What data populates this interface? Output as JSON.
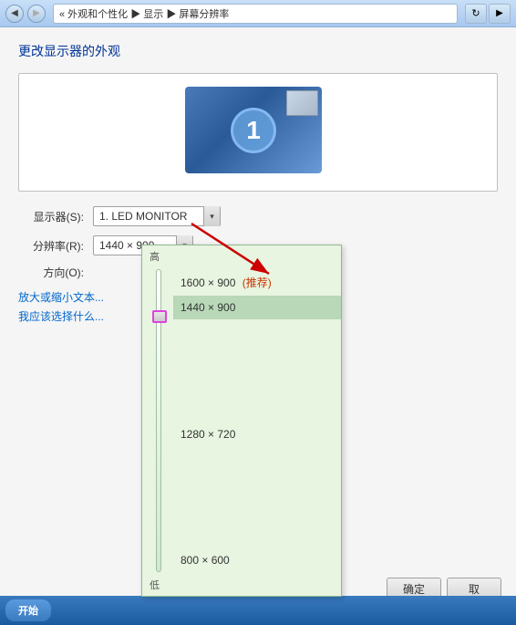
{
  "window": {
    "title_bar": {
      "path": "« 外观和个性化 ▶ 显示 ▶ 屏幕分辨率",
      "back_btn": "◀",
      "forward_btn": "▶",
      "refresh_label": "↻"
    }
  },
  "page": {
    "title": "更改显示器的外观",
    "monitor_number": "1"
  },
  "form": {
    "display_label": "显示器(S):",
    "display_value": "1. LED MONITOR",
    "resolution_label": "分辨率(R):",
    "resolution_value": "1440 × 900",
    "orientation_label": "方向(O):"
  },
  "dropdown": {
    "label_high": "高",
    "label_low": "低",
    "items": [
      {
        "label": "1600 × 900 (推荐)",
        "recommended": true,
        "selected": false
      },
      {
        "label": "1440 × 900",
        "recommended": false,
        "selected": true
      },
      {
        "label": "1280 × 720",
        "recommended": false,
        "selected": false
      },
      {
        "label": "800 × 600",
        "recommended": false,
        "selected": false
      }
    ]
  },
  "links": {
    "enlarge": "放大或缩小文本...",
    "help": "我应该选择什么..."
  },
  "buttons": {
    "ok": "确定",
    "cancel": "取"
  },
  "taskbar": {
    "start": "开始"
  }
}
